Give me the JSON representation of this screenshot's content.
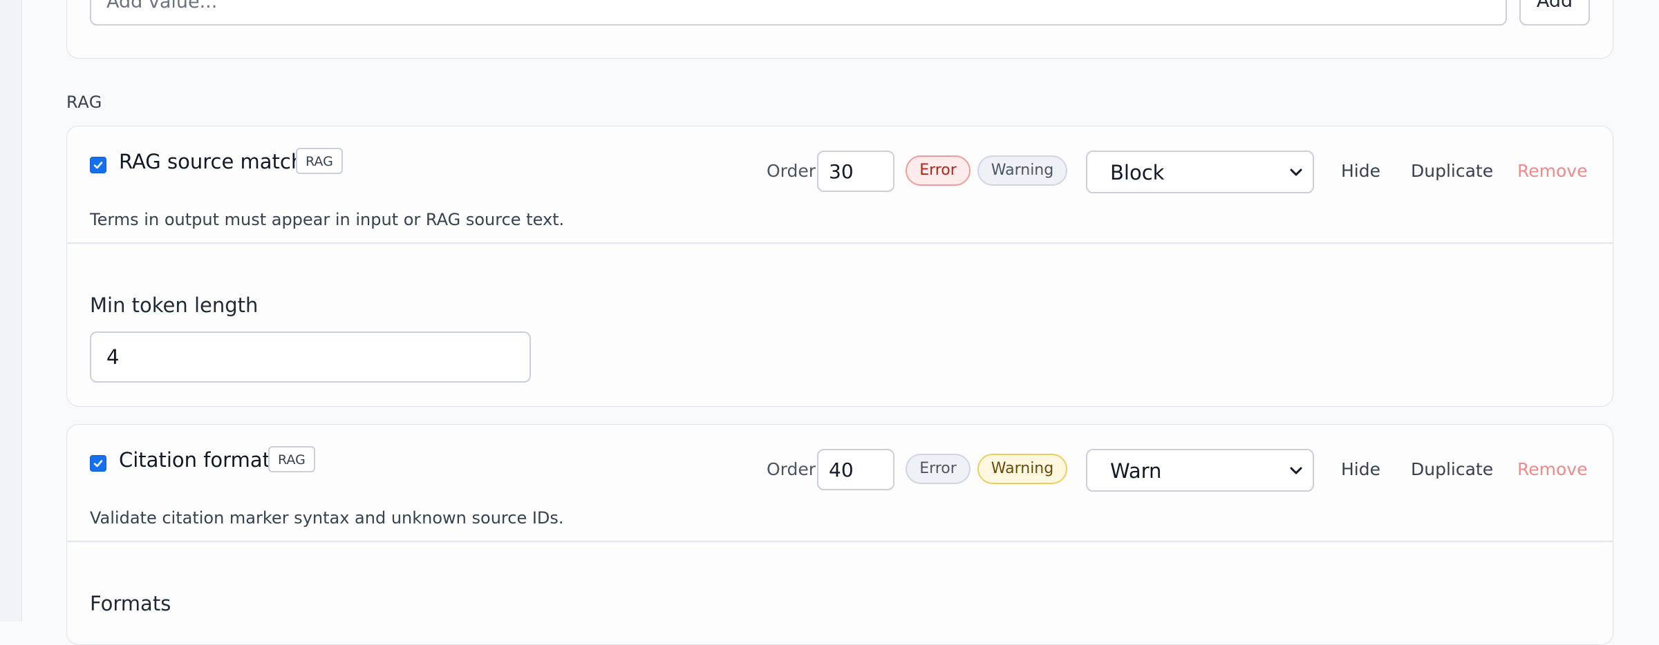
{
  "add_value": {
    "placeholder": "Add value...",
    "button_label": "Add"
  },
  "section": {
    "label": "RAG"
  },
  "rules": [
    {
      "enabled": true,
      "title": "RAG source match",
      "tag": "RAG",
      "order_label": "Order",
      "order_value": "30",
      "severity_error": "Error",
      "severity_warning": "Warning",
      "active_severity": "Error",
      "action": "Block",
      "hide_label": "Hide",
      "duplicate_label": "Duplicate",
      "remove_label": "Remove",
      "description": "Terms in output must appear in input or RAG source text.",
      "field_label": "Min token length",
      "field_value": "4"
    },
    {
      "enabled": true,
      "title": "Citation format",
      "tag": "RAG",
      "order_label": "Order",
      "order_value": "40",
      "severity_error": "Error",
      "severity_warning": "Warning",
      "active_severity": "Warning",
      "action": "Warn",
      "hide_label": "Hide",
      "duplicate_label": "Duplicate",
      "remove_label": "Remove",
      "description": "Validate citation marker syntax and unknown source IDs.",
      "field_label": "Formats"
    }
  ],
  "colors": {
    "accent": "#1570ef",
    "error_pill_bg": "#fdeceb",
    "error_pill_text": "#b42318",
    "warning_pill_bg": "#fff8e1",
    "warning_pill_text": "#6b4a08",
    "remove_link": "#ee8a8a"
  },
  "icons": {
    "checkbox": "check-icon",
    "select": "chevron-down-icon"
  }
}
